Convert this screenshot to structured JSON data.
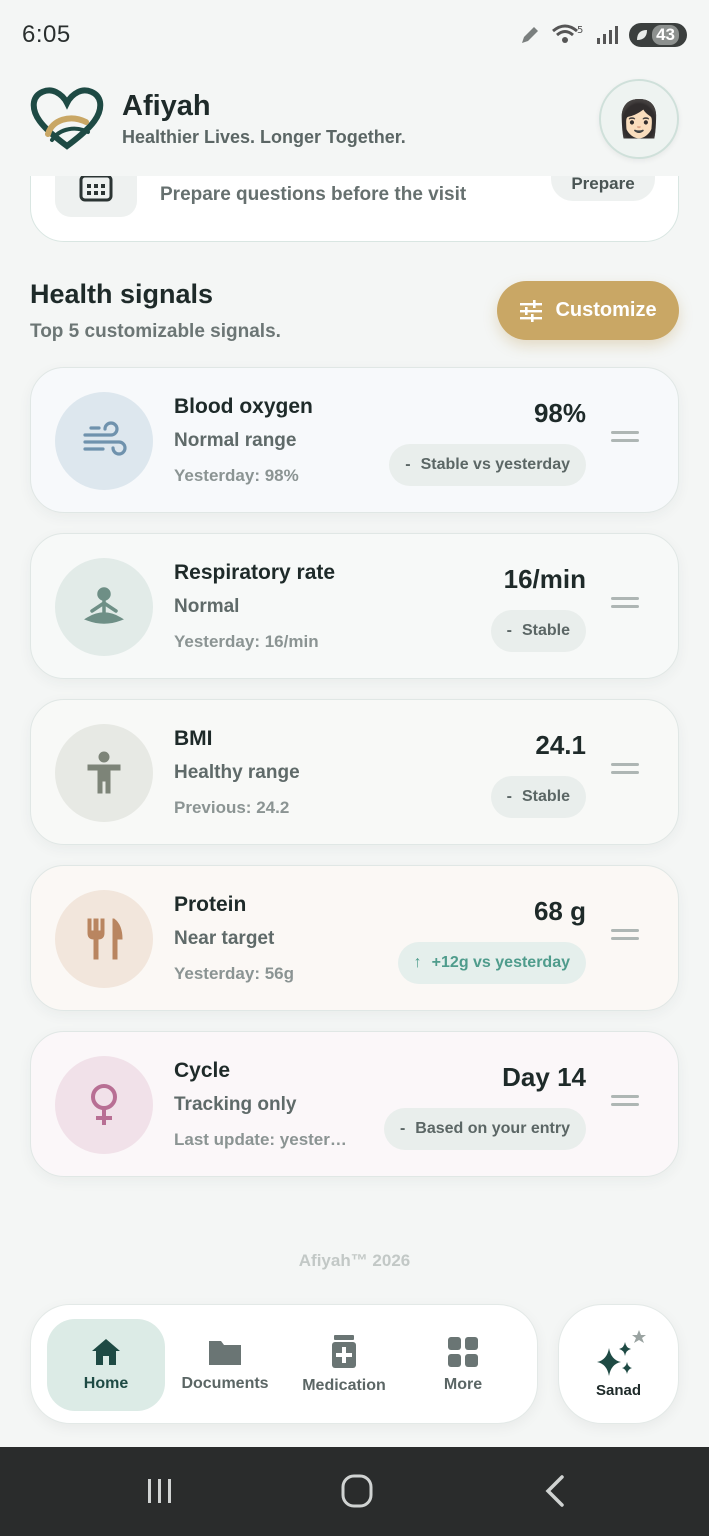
{
  "status_bar": {
    "time": "6:05",
    "battery": "43"
  },
  "header": {
    "title": "Afiyah",
    "tagline": "Healthier Lives. Longer Together.",
    "avatar_emoji": "👩🏻"
  },
  "prep_card": {
    "text": "Prepare questions before the visit",
    "button_label": "Prepare"
  },
  "health_signals": {
    "title": "Health signals",
    "subtitle": "Top 5 customizable signals.",
    "customize_label": "Customize",
    "items": [
      {
        "name": "Blood oxygen",
        "status": "Normal range",
        "previous": "Yesterday: 98%",
        "value": "98%",
        "trend_symbol": "-",
        "trend": "Stable vs yesterday",
        "icon": "wind-icon",
        "bg": "#f7f9fb",
        "icon_bg": "#dde7ee",
        "icon_color": "#6f92ad"
      },
      {
        "name": "Respiratory rate",
        "status": "Normal",
        "previous": "Yesterday: 16/min",
        "value": "16/min",
        "trend_symbol": "-",
        "trend": "Stable",
        "icon": "meditation-icon",
        "bg": "#f7f9f8",
        "icon_bg": "#e2ebe8",
        "icon_color": "#6e8f86"
      },
      {
        "name": "BMI",
        "status": "Healthy range",
        "previous": "Previous: 24.2",
        "value": "24.1",
        "trend_symbol": "-",
        "trend": "Stable",
        "icon": "body-icon",
        "bg": "#f8f9f7",
        "icon_bg": "#e7e9e4",
        "icon_color": "#7d8478"
      },
      {
        "name": "Protein",
        "status": "Near target",
        "previous": "Yesterday: 56g",
        "value": "68 g",
        "trend_symbol": "↑",
        "trend": "+12g vs yesterday",
        "icon": "utensils-icon",
        "bg": "#fbf8f5",
        "icon_bg": "#f2e6dc",
        "icon_color": "#b98560"
      },
      {
        "name": "Cycle",
        "status": "Tracking only",
        "previous": "Last update: yesterday",
        "value": "Day 14",
        "trend_symbol": "-",
        "trend": "Based on your entry",
        "icon": "female-icon",
        "bg": "#fbf7f9",
        "icon_bg": "#f1e1e9",
        "icon_color": "#b86f94"
      }
    ]
  },
  "footer": "Afiyah™ 2026",
  "bottom_nav": {
    "items": [
      {
        "label": "Home",
        "icon": "home-icon",
        "active": true
      },
      {
        "label": "Documents",
        "icon": "folder-icon",
        "active": false
      },
      {
        "label": "Medication",
        "icon": "medication-icon",
        "active": false
      },
      {
        "label": "More",
        "icon": "grid-icon",
        "active": false
      }
    ],
    "sanad_label": "Sanad"
  }
}
